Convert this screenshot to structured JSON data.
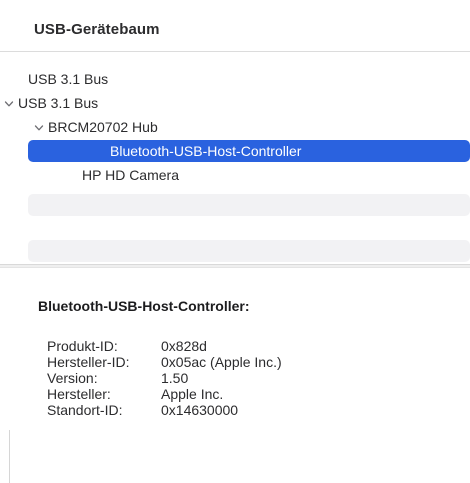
{
  "header": {
    "title": "USB-Gerätebaum"
  },
  "tree": {
    "items": [
      {
        "label": "USB 3.1 Bus",
        "expanded": false,
        "has_children": false,
        "selected": false
      },
      {
        "label": "USB 3.1 Bus",
        "expanded": true,
        "has_children": true,
        "selected": false
      },
      {
        "label": "BRCM20702 Hub",
        "expanded": true,
        "has_children": true,
        "selected": false
      },
      {
        "label": "Bluetooth-USB-Host-Controller",
        "expanded": false,
        "has_children": false,
        "selected": true
      },
      {
        "label": "HP HD Camera",
        "expanded": false,
        "has_children": false,
        "selected": false
      }
    ],
    "selection_color": "#2a62df"
  },
  "detail": {
    "title": "Bluetooth-USB-Host-Controller:",
    "properties": [
      {
        "label": "Produkt-ID:",
        "value": "0x828d"
      },
      {
        "label": "Hersteller-ID:",
        "value": "0x05ac (Apple Inc.)"
      },
      {
        "label": "Version:",
        "value": "1.50"
      },
      {
        "label": "Hersteller:",
        "value": "Apple Inc."
      },
      {
        "label": "Standort-ID:",
        "value": "0x14630000"
      }
    ]
  }
}
